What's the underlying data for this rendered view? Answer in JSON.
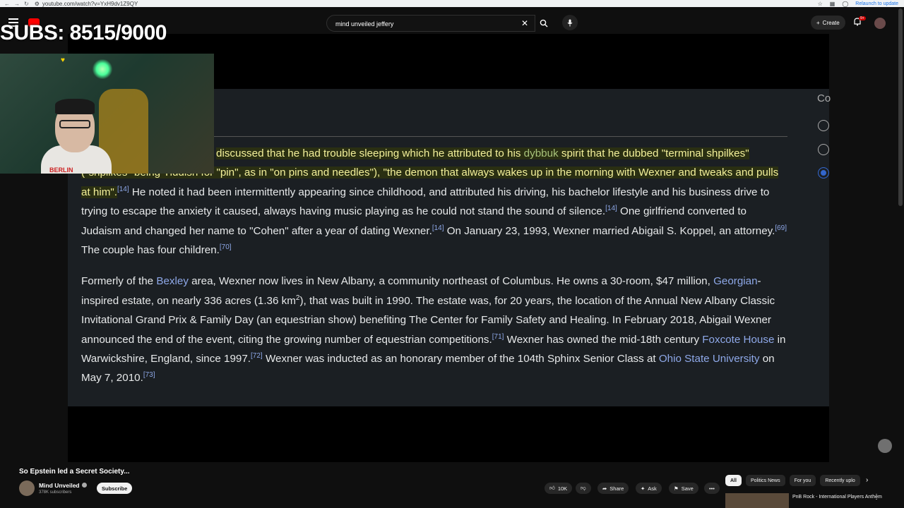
{
  "browser": {
    "url": "youtube.com/watch?v=YxH9dv1Z9QY",
    "relaunch_label": "Relaunch to update"
  },
  "header": {
    "search_query": "mind unveiled jeffery",
    "create_label": "Create",
    "notif_badge": "9+"
  },
  "overlay": {
    "subs_text": "SUBS: 8515/9000"
  },
  "webcam": {
    "shirt_text": "BERLIN"
  },
  "article": {
    "side_label": "Co",
    "p1": {
      "s1": "discussed that he had trouble sleeping which he attributed to his ",
      "link1": "dybbuk",
      "s2": " spirit that he dubbed \"terminal shpilkes\" (\"shpilkes\" being Yiddish for \"pin\", as in \"on pins and needles\"), \"the demon that always wakes up in the morning with Wexner and tweaks and pulls at him\".",
      "ref1": "[14]",
      "s3": " He noted it had been intermittently appearing since childhood, and attributed his driving, his bachelor lifestyle and his business drive to trying to escape the anxiety it caused, always having music playing as he could not stand the sound of silence.",
      "ref2": "[14]",
      "s4": " One girlfriend converted to Judaism and changed her name to \"Cohen\" after a year of dating Wexner.",
      "ref3": "[14]",
      "s5": " On January 23, 1993, Wexner married Abigail S. Koppel, an attorney.",
      "ref4": "[69]",
      "s6": " The couple has four children.",
      "ref5": "[70]"
    },
    "p2": {
      "s1": "Formerly of the ",
      "link1": "Bexley",
      "s2": " area, Wexner now lives in New Albany, a community northeast of Columbus. He owns a 30-room, $47 million, ",
      "link2": "Georgian",
      "s3": "-inspired estate, on nearly 336 acres (1.36 km",
      "sup_km": "2",
      "s4": "), that was built in 1990. The estate was, for 20 years, the location of the Annual New Albany Classic Invitational Grand Prix & Family Day (an equestrian show) benefiting The Center for Family Safety and Healing. In February 2018, Abigail Wexner announced the end of the event, citing the growing number of equestrian competitions.",
      "ref1": "[71]",
      "s5": " Wexner has owned the mid-18th century ",
      "link3": "Foxcote House",
      "s6": " in Warwickshire, England, since 1997.",
      "ref2": "[72]",
      "s7": " Wexner was inducted as an honorary member of the 104th Sphinx Senior Class at ",
      "link4": "Ohio State University",
      "s8": " on May 7, 2010.",
      "ref3": "[73]"
    }
  },
  "video_info": {
    "title": "So Epstein led a Secret Society...",
    "channel": "Mind Unveiled",
    "subscribers": "378K subscribers",
    "subscribe_label": "Subscribe",
    "likes": "10K",
    "share_label": "Share",
    "ask_label": "Ask",
    "save_label": "Save",
    "more_label": "•••"
  },
  "chips": [
    "All",
    "Politics News",
    "For you",
    "Recently uplo"
  ],
  "recommendation": {
    "title": "PnB Rock - International Players Anthem"
  }
}
